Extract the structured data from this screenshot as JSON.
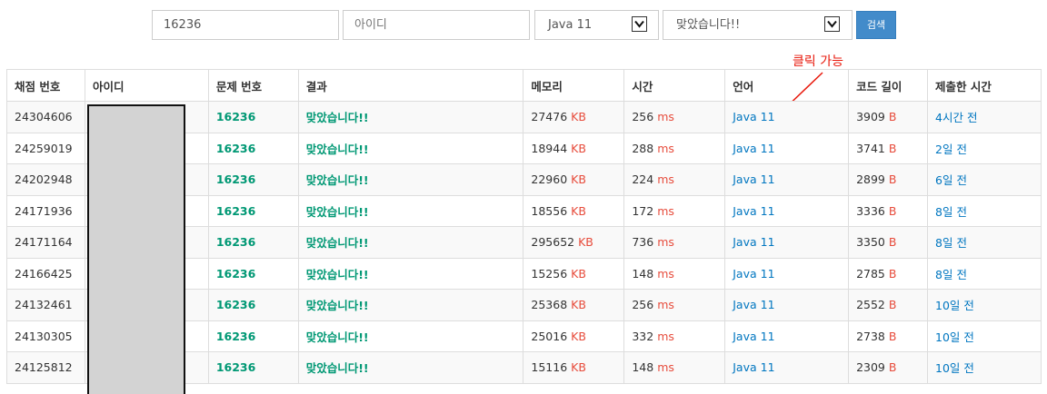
{
  "search": {
    "problem_value": "16236",
    "user_placeholder": "아이디",
    "language_selected": "Java 11",
    "result_selected": "맞았습니다!!",
    "search_button": "검색"
  },
  "table": {
    "headers": [
      "채점 번호",
      "아이디",
      "문제 번호",
      "결과",
      "메모리",
      "시간",
      "언어",
      "코드 길이",
      "제출한 시간"
    ],
    "rows": [
      {
        "id": "24304606",
        "problem": "16236",
        "result": "맞았습니다!!",
        "memory": "27476",
        "time": "256",
        "lang": "Java 11",
        "length": "3909",
        "submitted": "4시간 전"
      },
      {
        "id": "24259019",
        "problem": "16236",
        "result": "맞았습니다!!",
        "memory": "18944",
        "time": "288",
        "lang": "Java 11",
        "length": "3741",
        "submitted": "2일 전"
      },
      {
        "id": "24202948",
        "problem": "16236",
        "result": "맞았습니다!!",
        "memory": "22960",
        "time": "224",
        "lang": "Java 11",
        "length": "2899",
        "submitted": "6일 전"
      },
      {
        "id": "24171936",
        "problem": "16236",
        "result": "맞았습니다!!",
        "memory": "18556",
        "time": "172",
        "lang": "Java 11",
        "length": "3336",
        "submitted": "8일 전"
      },
      {
        "id": "24171164",
        "problem": "16236",
        "result": "맞았습니다!!",
        "memory": "295652",
        "time": "736",
        "lang": "Java 11",
        "length": "3350",
        "submitted": "8일 전"
      },
      {
        "id": "24166425",
        "problem": "16236",
        "result": "맞았습니다!!",
        "memory": "15256",
        "time": "148",
        "lang": "Java 11",
        "length": "2785",
        "submitted": "8일 전"
      },
      {
        "id": "24132461",
        "problem": "16236",
        "result": "맞았습니다!!",
        "memory": "25368",
        "time": "256",
        "lang": "Java 11",
        "length": "2552",
        "submitted": "10일 전"
      },
      {
        "id": "24130305",
        "problem": "16236",
        "result": "맞았습니다!!",
        "memory": "25016",
        "time": "332",
        "lang": "Java 11",
        "length": "2738",
        "submitted": "10일 전"
      },
      {
        "id": "24125812",
        "problem": "16236",
        "result": "맞았습니다!!",
        "memory": "15116",
        "time": "148",
        "lang": "Java 11",
        "length": "2309",
        "submitted": "10일 전"
      }
    ],
    "units": {
      "memory": "KB",
      "time": "ms",
      "length": "B"
    }
  },
  "annotation": {
    "text": "클릭 가능",
    "color": "#e8190c"
  },
  "colors": {
    "accent": "#428bca",
    "success": "#009874",
    "unit": "#e74c3c",
    "link": "#0076c0"
  }
}
